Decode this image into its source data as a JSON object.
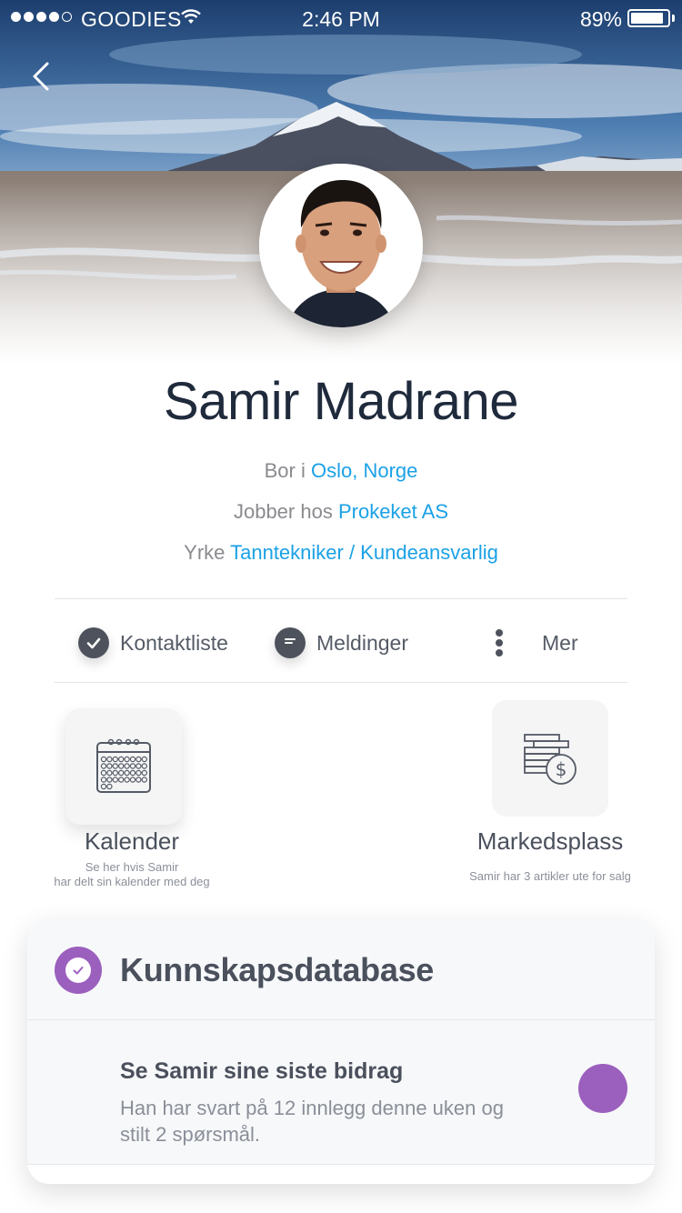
{
  "status_bar": {
    "carrier": "GOODIES",
    "time": "2:46 PM",
    "battery_percent": "89%",
    "battery_level": 0.89,
    "signal_bars_filled": 4
  },
  "profile": {
    "name": "Samir Madrane",
    "location_prefix": "Bor i",
    "location": "Oslo, Norge",
    "employer_prefix": "Jobber hos",
    "employer": "Prokeket AS",
    "title_prefix": "Yrke",
    "title": "Tanntekniker / Kundeansvarlig"
  },
  "actions": [
    {
      "label": "Kontaktliste",
      "icon": "check-circle-icon"
    },
    {
      "label": "Meldinger",
      "icon": "chat-bubble-icon"
    },
    {
      "label": "Mer",
      "icon": "more-vertical-icon"
    }
  ],
  "tiles": {
    "calendar": {
      "title": "Kalender",
      "subtitle_line1": "Se her hvis Samir",
      "subtitle_line2": "har delt sin kalender med deg",
      "icon": "calendar-icon"
    },
    "market": {
      "title": "Markedsplass",
      "subtitle": "Samir har 3 artikler ute for salg",
      "icon": "coins-dollar-icon"
    }
  },
  "knowledge_card": {
    "title": "Kunnskapsdatabase",
    "row_title": "Se Samir sine siste bidrag",
    "row_subtitle": "Han har svart på 12 innlegg denne uken og stilt 2 spørsmål."
  },
  "colors": {
    "link": "#1aa1e6",
    "accent_purple": "#9b5fbd",
    "name_text": "#1f2a3c"
  }
}
